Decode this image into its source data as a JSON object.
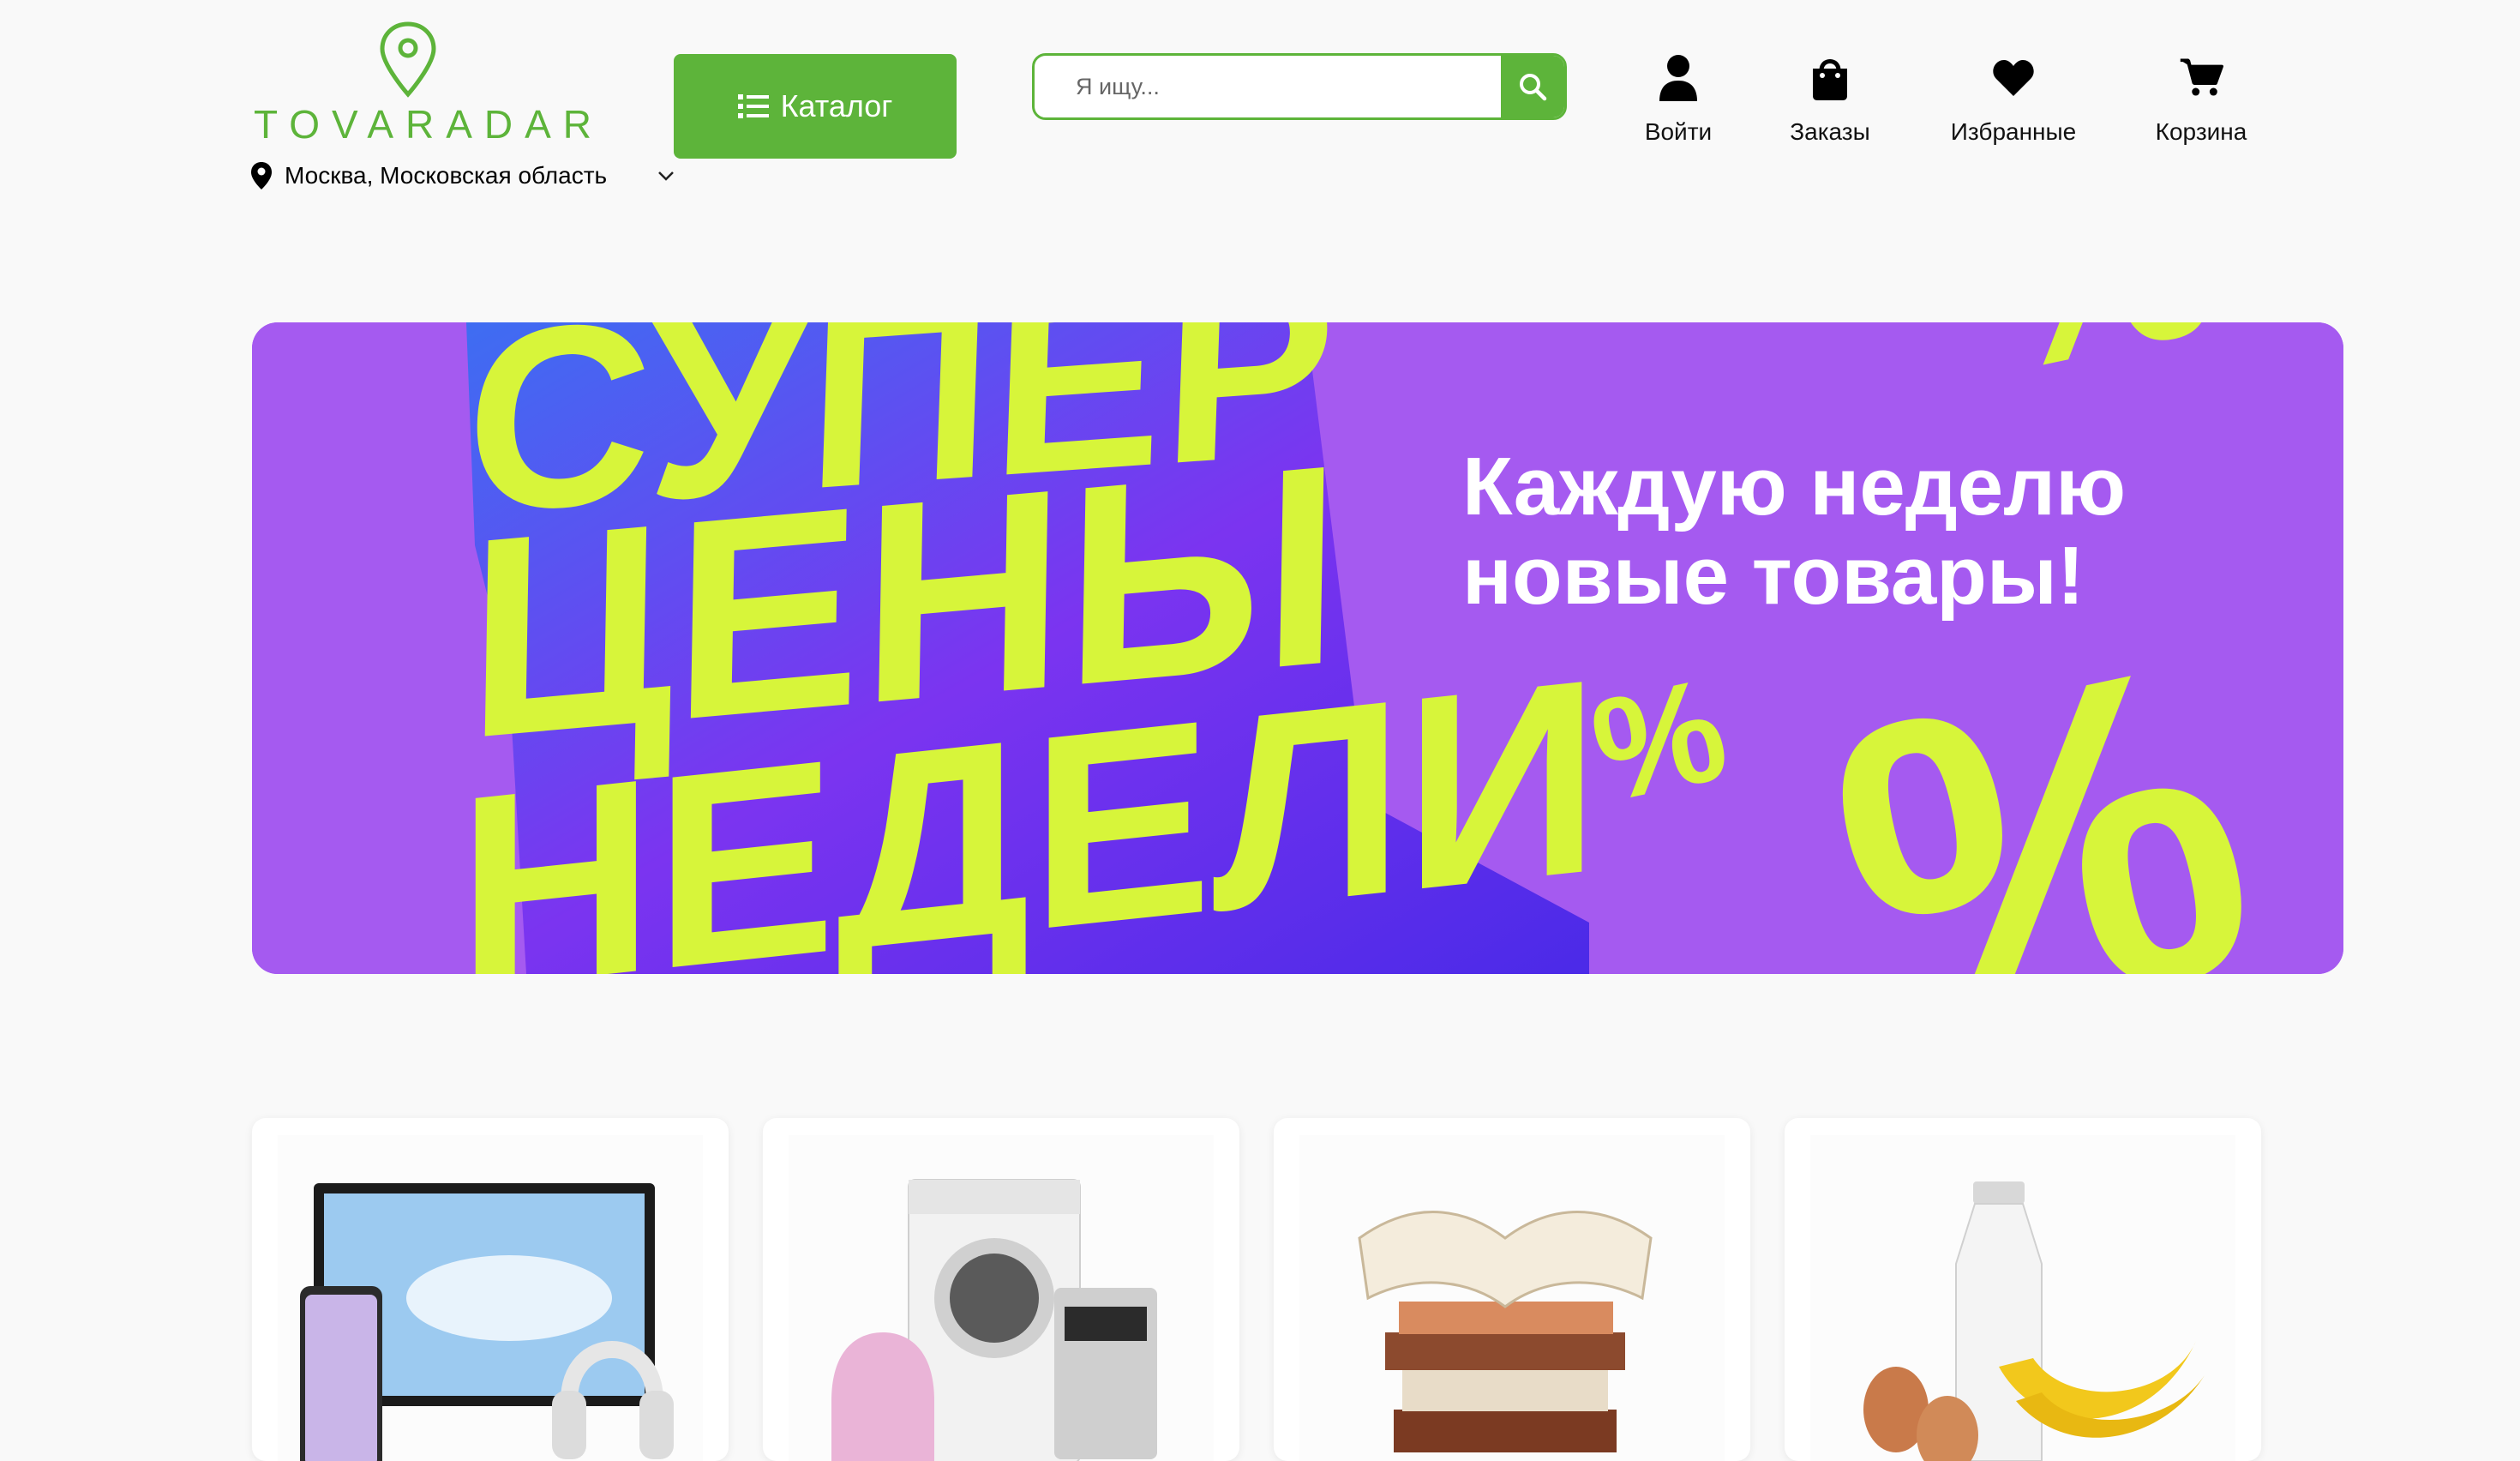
{
  "logo": {
    "text": "TOVARADAR",
    "color": "#5db43a"
  },
  "location": {
    "text": "Москва, Московская область",
    "icon": "map-pin-icon"
  },
  "catalog": {
    "label": "Каталог",
    "icon": "list-icon"
  },
  "search": {
    "placeholder": "Я ищу...",
    "icon": "search-icon"
  },
  "nav": [
    {
      "label": "Войти",
      "icon": "user-icon"
    },
    {
      "label": "Заказы",
      "icon": "shopping-bag-icon"
    },
    {
      "label": "Избранные",
      "icon": "heart-icon"
    },
    {
      "label": "Корзина",
      "icon": "cart-icon"
    }
  ],
  "banner": {
    "headline": [
      "СУПЕР",
      "ЦЕНЫ",
      "НЕДЕЛИ"
    ],
    "tagline_line1": "Каждую неделю",
    "tagline_line2": "новые товары!",
    "background": "#a55af0",
    "accent": "#d7f53a"
  },
  "categories": [
    {
      "name": "electronics-card"
    },
    {
      "name": "appliances-card"
    },
    {
      "name": "books-card"
    },
    {
      "name": "grocery-card"
    }
  ],
  "colors": {
    "brand": "#5db43a",
    "page_bg": "#f9f9f9"
  }
}
